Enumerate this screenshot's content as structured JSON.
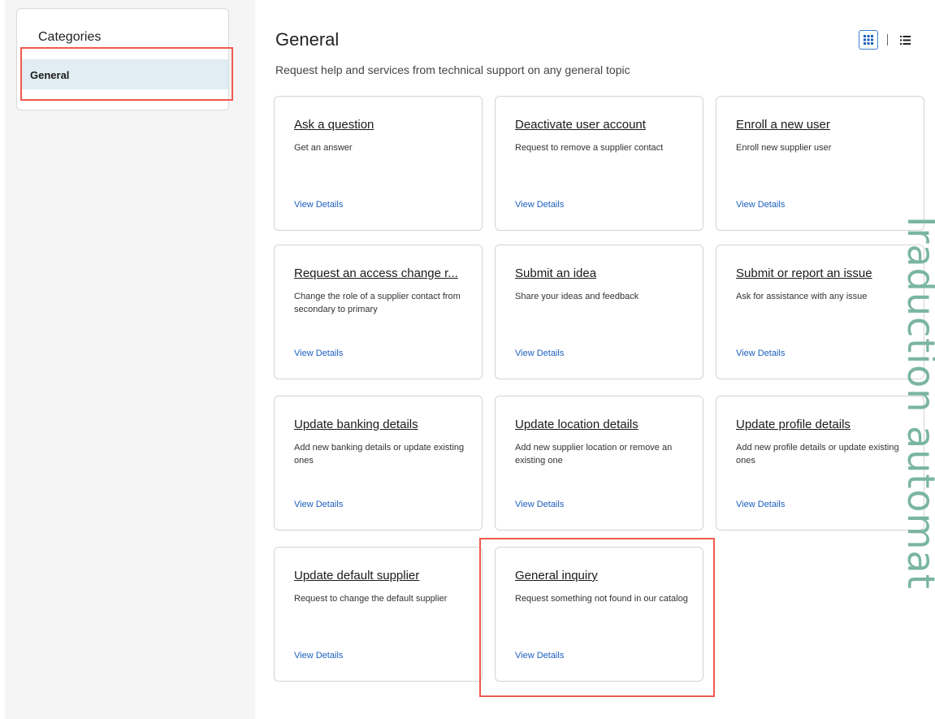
{
  "sidebar": {
    "title": "Categories",
    "items": [
      {
        "label": "General",
        "selected": true
      }
    ]
  },
  "main": {
    "title": "General",
    "subtitle": "Request help and services from technical support on any general topic",
    "view_toggle": {
      "grid_icon": "grid-icon",
      "list_icon": "list-icon",
      "active": "grid"
    }
  },
  "cards": [
    {
      "title": "Ask a question",
      "description": "Get an answer",
      "link": "View Details"
    },
    {
      "title": "Deactivate user account",
      "description": "Request to remove a supplier contact",
      "link": "View Details"
    },
    {
      "title": "Enroll a new user",
      "description": "Enroll new supplier user",
      "link": "View Details"
    },
    {
      "title": "Request an access change r...",
      "description": "Change the role of a supplier contact from secondary to primary",
      "link": "View Details"
    },
    {
      "title": "Submit an idea",
      "description": "Share your ideas and feedback",
      "link": "View Details"
    },
    {
      "title": "Submit or report an issue",
      "description": "Ask for assistance with any issue",
      "link": "View Details"
    },
    {
      "title": "Update banking details",
      "description": "Add new banking details or update existing ones",
      "link": "View Details"
    },
    {
      "title": "Update location details",
      "description": "Add new supplier location or remove an existing one",
      "link": "View Details"
    },
    {
      "title": "Update profile details",
      "description": "Add new profile details or update existing ones",
      "link": "View Details"
    },
    {
      "title": "Update default supplier",
      "description": "Request to change the default supplier",
      "link": "View Details"
    },
    {
      "title": "General inquiry",
      "description": "Request something not found in our catalog",
      "link": "View Details"
    }
  ],
  "watermark": {
    "text": "Iraduction automat"
  },
  "colors": {
    "accent": "#3b7fd8",
    "link": "#1c5fbf",
    "highlight": "#ef5a4f",
    "selected_bg": "#e1edf3",
    "watermark": "#7ab5a0"
  }
}
